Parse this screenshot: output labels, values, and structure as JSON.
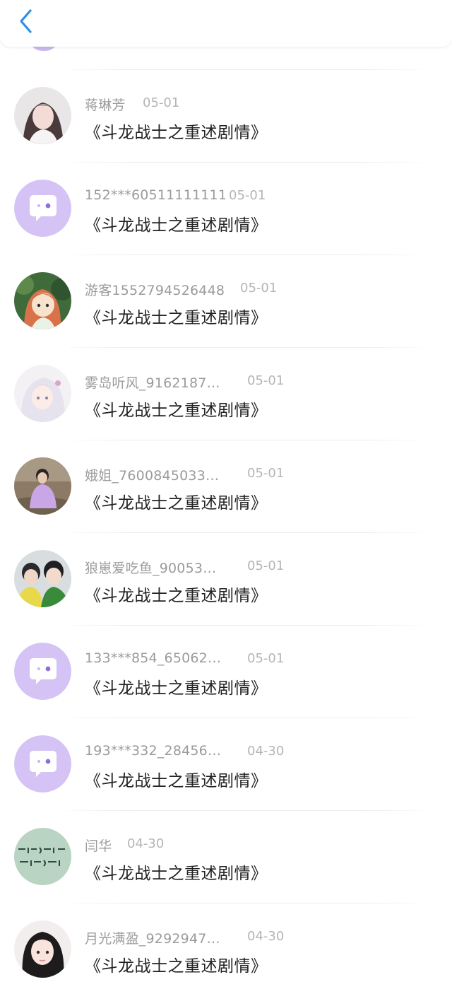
{
  "header": {
    "back_icon": "chevron-left-icon",
    "accent": "#2f8fe6"
  },
  "items": [
    {
      "name": "蒋琳芳",
      "date": "05-01",
      "title": "《斗龙战士之重述剧情》",
      "avatar": "photo-girl-1"
    },
    {
      "name": "152***60511111111",
      "date": "05-01",
      "title": "《斗龙战士之重述剧情》",
      "avatar": "default-chat-bubble"
    },
    {
      "name": "游客1552794526448",
      "date": "05-01",
      "title": "《斗龙战士之重述剧情》",
      "avatar": "anime-red-hair-girl"
    },
    {
      "name": "雾岛听风_9162187…",
      "date": "05-01",
      "title": "《斗龙战士之重述剧情》",
      "avatar": "anime-white-hair-girl"
    },
    {
      "name": "娥姐_7600845033…",
      "date": "05-01",
      "title": "《斗龙战士之重述剧情》",
      "avatar": "photo-purple-coat"
    },
    {
      "name": "狼崽爱吃鱼_90053…",
      "date": "05-01",
      "title": "《斗龙战士之重述剧情》",
      "avatar": "photo-two-boys"
    },
    {
      "name": "133***854_65062…",
      "date": "05-01",
      "title": "《斗龙战士之重述剧情》",
      "avatar": "default-chat-bubble"
    },
    {
      "name": "193***332_28456…",
      "date": "04-30",
      "title": "《斗龙战士之重述剧情》",
      "avatar": "default-chat-bubble"
    },
    {
      "name": "闫华",
      "date": "04-30",
      "title": "《斗龙战士之重述剧情》",
      "avatar": "calligraphy-text"
    },
    {
      "name": "月光满盈_9292947…",
      "date": "04-30",
      "title": "《斗龙战士之重述剧情》",
      "avatar": "photo-girl-black-hair"
    }
  ]
}
